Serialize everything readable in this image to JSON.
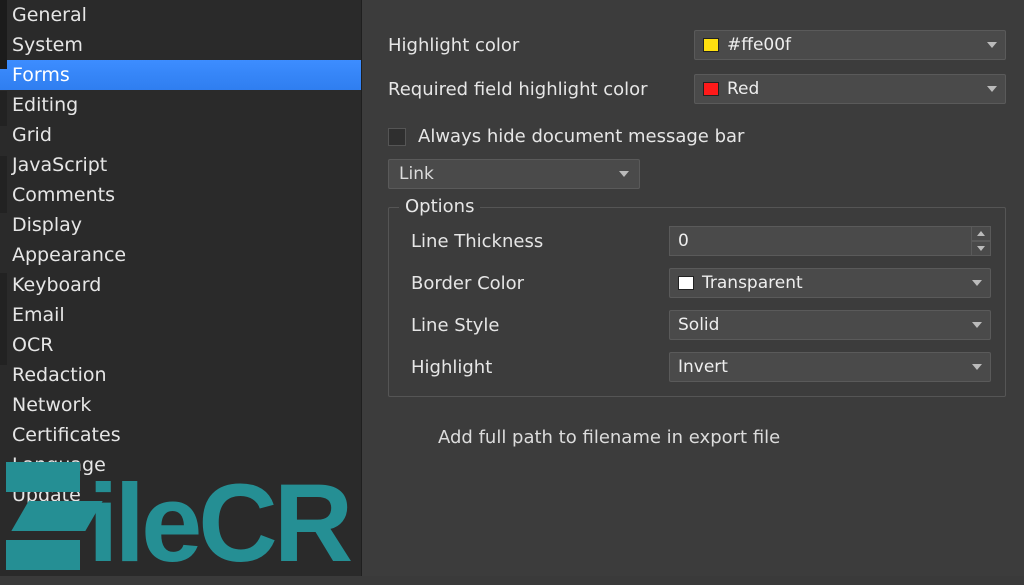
{
  "sidebar": {
    "items": [
      {
        "label": "General"
      },
      {
        "label": "System"
      },
      {
        "label": "Forms",
        "selected": true
      },
      {
        "label": "Editing"
      },
      {
        "label": "Grid"
      },
      {
        "label": "JavaScript"
      },
      {
        "label": "Comments"
      },
      {
        "label": "Display"
      },
      {
        "label": "Appearance"
      },
      {
        "label": "Keyboard"
      },
      {
        "label": "Email"
      },
      {
        "label": "OCR"
      },
      {
        "label": "Redaction"
      },
      {
        "label": "Network"
      },
      {
        "label": "Certificates"
      },
      {
        "label": "Language"
      },
      {
        "label": "Update"
      }
    ]
  },
  "main": {
    "highlight_color": {
      "label": "Highlight color",
      "swatch": "#ffe00f",
      "value": "#ffe00f"
    },
    "required_color": {
      "label": "Required field highlight color",
      "swatch": "#ff1a1a",
      "value": "Red"
    },
    "hide_msgbar": {
      "label": "Always hide document message bar",
      "checked": false
    },
    "link_select": {
      "value": "Link"
    },
    "options": {
      "title": "Options",
      "line_thickness": {
        "label": "Line Thickness",
        "value": "0"
      },
      "border_color": {
        "label": "Border Color",
        "swatch": "#ffffff",
        "value": "Transparent"
      },
      "line_style": {
        "label": "Line Style",
        "value": "Solid"
      },
      "highlight": {
        "label": "Highlight",
        "value": "Invert"
      }
    },
    "export_path": {
      "label": "Add full path to filename in export file",
      "checked": false
    }
  },
  "watermark": {
    "text": "ileCR"
  }
}
